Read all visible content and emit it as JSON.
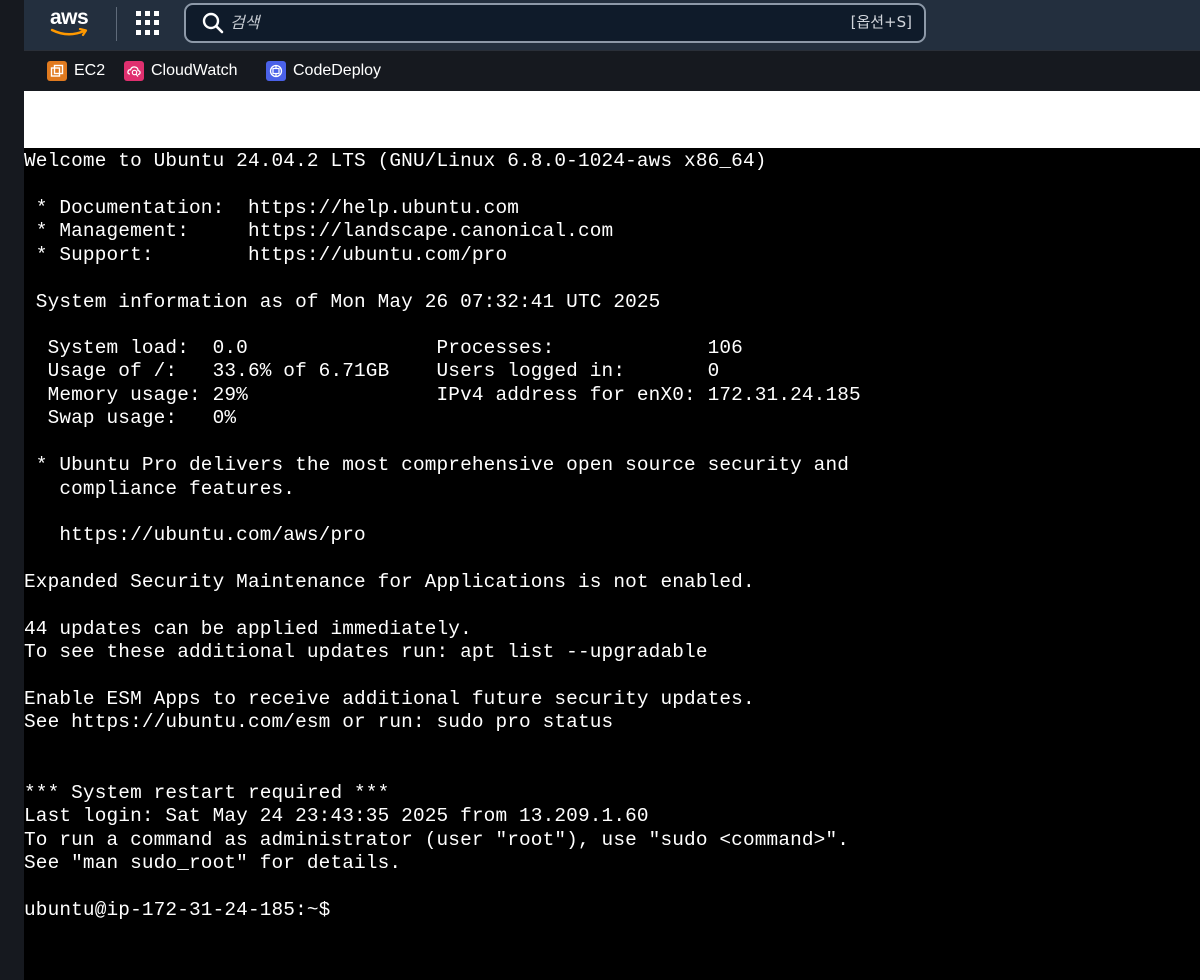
{
  "topbar": {
    "logo_text": "aws",
    "search": {
      "placeholder": "검색",
      "shortcut": "[옵션+S]"
    }
  },
  "favorites": [
    {
      "label": "EC2",
      "icon": "ec2-icon",
      "color": "#e07a1f"
    },
    {
      "label": "CloudWatch",
      "icon": "cloudwatch-icon",
      "color": "#e0306f"
    },
    {
      "label": "CodeDeploy",
      "icon": "codedeploy-icon",
      "color": "#4a61e8"
    }
  ],
  "terminal": {
    "lines": [
      "Welcome to Ubuntu 24.04.2 LTS (GNU/Linux 6.8.0-1024-aws x86_64)",
      "",
      " * Documentation:  https://help.ubuntu.com",
      " * Management:     https://landscape.canonical.com",
      " * Support:        https://ubuntu.com/pro",
      "",
      " System information as of Mon May 26 07:32:41 UTC 2025",
      "",
      "  System load:  0.0                Processes:             106",
      "  Usage of /:   33.6% of 6.71GB    Users logged in:       0",
      "  Memory usage: 29%                IPv4 address for enX0: 172.31.24.185",
      "  Swap usage:   0%",
      "",
      " * Ubuntu Pro delivers the most comprehensive open source security and",
      "   compliance features.",
      "",
      "   https://ubuntu.com/aws/pro",
      "",
      "Expanded Security Maintenance for Applications is not enabled.",
      "",
      "44 updates can be applied immediately.",
      "To see these additional updates run: apt list --upgradable",
      "",
      "Enable ESM Apps to receive additional future security updates.",
      "See https://ubuntu.com/esm or run: sudo pro status",
      "",
      "",
      "*** System restart required ***",
      "Last login: Sat May 24 23:43:35 2025 from 13.209.1.60",
      "To run a command as administrator (user \"root\"), use \"sudo <command>\".",
      "See \"man sudo_root\" for details.",
      "",
      "ubuntu@ip-172-31-24-185:~$"
    ]
  }
}
